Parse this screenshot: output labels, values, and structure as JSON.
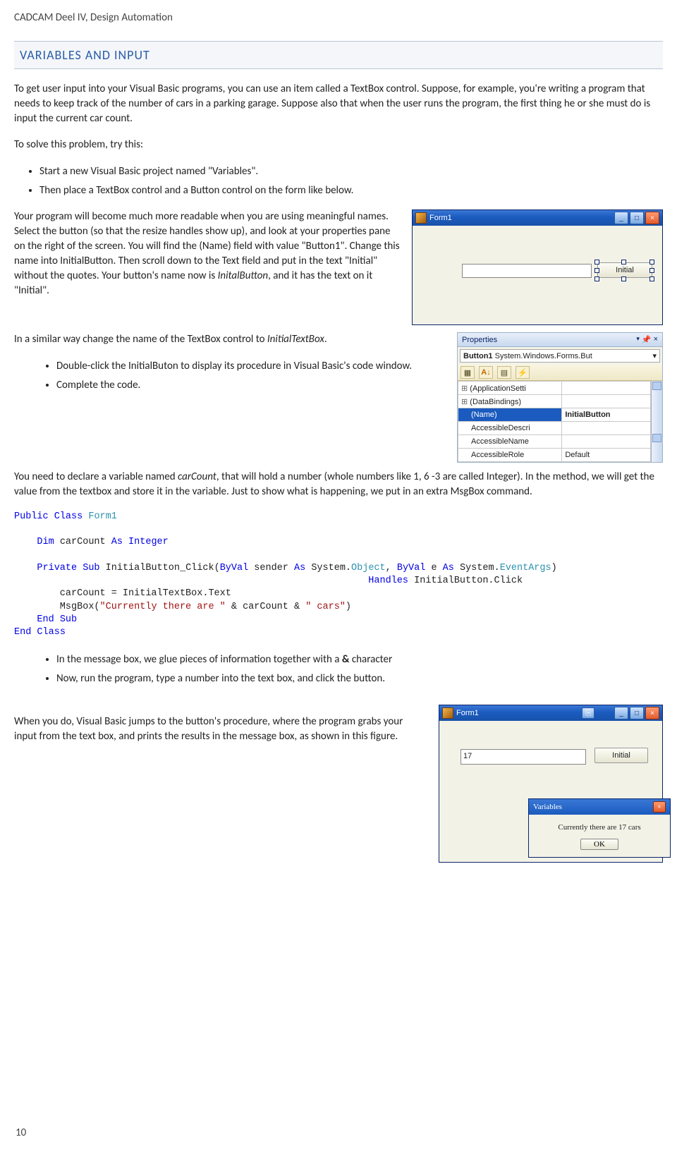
{
  "header": "CADCAM Deel IV, Design Automation",
  "section_title": "VARIABLES AND INPUT",
  "p1": "To get user input into your Visual Basic programs, you can use an item called a TextBox control. Suppose, for example, you're writing a program that needs to keep track of the number of cars in a parking garage. Suppose also that when the user runs the program, the first thing he or she must do is input the current car count.",
  "p2": "To solve this problem, try this:",
  "bullets1": [
    "Start a new Visual Basic project named \"Variables\".",
    "Then place a TextBox control and a Button control on the form like below."
  ],
  "p3_a": "Your program will become much more readable when you are using meaningful names. Select the button (so that the resize handles show up), and look at your properties pane on the right of the screen. You will find the (Name) field with value \"Button1\". Change this name into InitialButton. Then scroll down to the Text field and put in the text \"Initial\" without the quotes. Your button's name now is ",
  "p3_italic": "InitalButton",
  "p3_b": ", and it has the text on it \"Initial\".",
  "p4_a": "In a similar way change the name of the TextBox control to ",
  "p4_italic": "InitialTextBox",
  "p4_b": ".",
  "bullets2": [
    "Double-click the InitialButon to display its procedure in Visual Basic's code window.",
    "Complete the code."
  ],
  "p5_a": "You need to declare a variable named ",
  "p5_italic": "carCount",
  "p5_b": ", that will hold a number (whole numbers like 1, 6 -3 are called Integer). In the method, we will get the value from the textbox and store it in the variable. Just to show what is happening, we put in an extra MsgBox command.",
  "code": {
    "l1a": "Public",
    "l1b": "Class",
    "l1c": "Form1",
    "l2a": "Dim",
    "l2b": " carCount ",
    "l2c": "As",
    "l2d": "Integer",
    "l3a": "Private",
    "l3b": "Sub",
    "l3c": " InitialButton_Click(",
    "l3d": "ByVal",
    "l3e": " sender ",
    "l3f": "As",
    "l3g": " System.",
    "l3h": "Object",
    "l3i": ", ",
    "l3j": "ByVal",
    "l3k": " e ",
    "l3l": "As",
    "l3m": " System.",
    "l3n": "EventArgs",
    "l3o": ")",
    "l3p": "Handles",
    "l3q": " InitialButton.Click",
    "l4": "        carCount = InitialTextBox.Text",
    "l5a": "        MsgBox(",
    "l5b": "\"Currently there are \"",
    "l5c": " & carCount & ",
    "l5d": "\" cars\"",
    "l5e": ")",
    "l6a": "End",
    "l6b": "Sub",
    "l7a": "End",
    "l7b": "Class"
  },
  "bullets3_a": "In the message box, we glue pieces of information together with a ",
  "bullets3_bold": "&",
  "bullets3_b": " character",
  "bullets3_2": "Now, run the program, type a number into the text box, and click the button.",
  "p6": "When you do, Visual Basic jumps to the button's procedure, where the program grabs your input from the text box, and prints the results in the message box, as shown in this figure.",
  "page_number": "10",
  "vb_form1": {
    "title": "Form1",
    "button_text": "Initial"
  },
  "props": {
    "title": "Properties",
    "object": "Button1",
    "object_type": "System.Windows.Forms.But",
    "rows": {
      "app": "(ApplicationSetti",
      "db": "(DataBindings)",
      "name_k": "(Name)",
      "name_v": "InitialButton",
      "ad": "AccessibleDescri",
      "an": "AccessibleName",
      "ar_k": "AccessibleRole",
      "ar_v": "Default"
    }
  },
  "vb_form2": {
    "title": "Form1",
    "textbox_value": "17",
    "button_text": "Initial"
  },
  "msgbox": {
    "title": "Variables",
    "text": "Currently there are 17 cars",
    "ok": "OK"
  }
}
